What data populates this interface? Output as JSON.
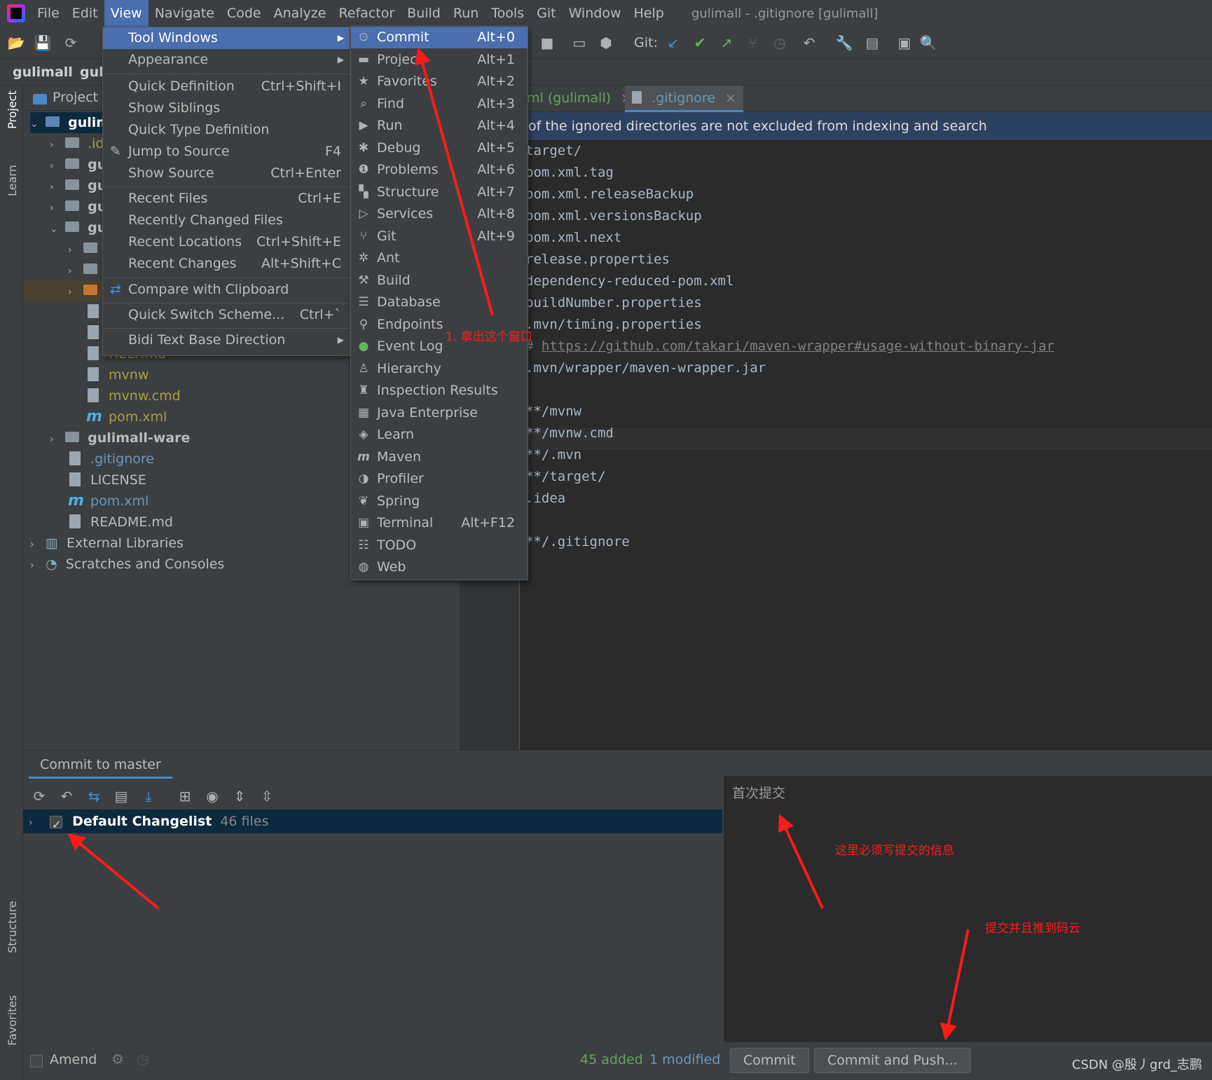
{
  "menubar": {
    "items": [
      "File",
      "Edit",
      "View",
      "Navigate",
      "Code",
      "Analyze",
      "Refactor",
      "Build",
      "Run",
      "Tools",
      "Git",
      "Window",
      "Help"
    ],
    "window_title": "gulimall - .gitignore [gulimall]"
  },
  "toolbar": {
    "git_label": "Git:"
  },
  "breadcrumb": {
    "root": "gulimall",
    "sub": "guli"
  },
  "left_stripe": {
    "project": "Project",
    "learn": "Learn",
    "structure": "Structure",
    "favorites": "Favorites"
  },
  "project_panel": {
    "title": "Project",
    "tree": {
      "root": "gulim",
      "idea": ".id",
      "gu1": "gu",
      "gu2": "gu",
      "gu3": "gu",
      "gu4": "gu",
      "help": "HELP.md",
      "mvnw": "mvnw",
      "mvnw_cmd": "mvnw.cmd",
      "pom_inner": "pom.xml",
      "ware": "gulimall-ware",
      "gitignore": ".gitignore",
      "license": "LICENSE",
      "pom": "pom.xml",
      "readme": "README.md",
      "ext_libs": "External Libraries",
      "scratches": "Scratches and Consoles"
    }
  },
  "editor": {
    "tabs": [
      "ml (gulimall)",
      ".gitignore"
    ],
    "banner": "of the ignored directories are not excluded from indexing and search",
    "lines": [
      "target/",
      "pom.xml.tag",
      "pom.xml.releaseBackup",
      "pom.xml.versionsBackup",
      "pom.xml.next",
      "release.properties",
      "dependency-reduced-pom.xml",
      "buildNumber.properties",
      ".mvn/timing.properties",
      "# ",
      ".mvn/wrapper/maven-wrapper.jar",
      "",
      "**/mvnw",
      "**/mvnw.cmd",
      "**/.mvn",
      "**/target/",
      ".idea",
      "",
      "**/.gitignore"
    ],
    "link": "https://github.com/takari/maven-wrapper#usage-without-binary-jar"
  },
  "view_menu": {
    "items": [
      {
        "label": "Tool Windows",
        "shortcut": ""
      },
      {
        "label": "Appearance",
        "shortcut": ""
      },
      {
        "label": "Quick Definition",
        "shortcut": "Ctrl+Shift+I"
      },
      {
        "label": "Show Siblings",
        "shortcut": ""
      },
      {
        "label": "Quick Type Definition",
        "shortcut": ""
      },
      {
        "label": "Jump to Source",
        "shortcut": "F4"
      },
      {
        "label": "Show Source",
        "shortcut": "Ctrl+Enter"
      },
      {
        "label": "Recent Files",
        "shortcut": "Ctrl+E"
      },
      {
        "label": "Recently Changed Files",
        "shortcut": ""
      },
      {
        "label": "Recent Locations",
        "shortcut": "Ctrl+Shift+E"
      },
      {
        "label": "Recent Changes",
        "shortcut": "Alt+Shift+C"
      },
      {
        "label": "Compare with Clipboard",
        "shortcut": ""
      },
      {
        "label": "Quick Switch Scheme...",
        "shortcut": "Ctrl+`"
      },
      {
        "label": "Bidi Text Base Direction",
        "shortcut": ""
      }
    ]
  },
  "tool_windows_menu": {
    "items": [
      {
        "label": "Commit",
        "shortcut": "Alt+0",
        "icon": "commit-icon"
      },
      {
        "label": "Project",
        "shortcut": "Alt+1",
        "icon": "folder-icon"
      },
      {
        "label": "Favorites",
        "shortcut": "Alt+2",
        "icon": "star-icon"
      },
      {
        "label": "Find",
        "shortcut": "Alt+3",
        "icon": "search-icon"
      },
      {
        "label": "Run",
        "shortcut": "Alt+4",
        "icon": "play-icon"
      },
      {
        "label": "Debug",
        "shortcut": "Alt+5",
        "icon": "bug-icon"
      },
      {
        "label": "Problems",
        "shortcut": "Alt+6",
        "icon": "warning-icon"
      },
      {
        "label": "Structure",
        "shortcut": "Alt+7",
        "icon": "structure-icon"
      },
      {
        "label": "Services",
        "shortcut": "Alt+8",
        "icon": "services-icon"
      },
      {
        "label": "Git",
        "shortcut": "Alt+9",
        "icon": "git-icon"
      },
      {
        "label": "Ant",
        "shortcut": "",
        "icon": "ant-icon"
      },
      {
        "label": "Build",
        "shortcut": "",
        "icon": "hammer-icon"
      },
      {
        "label": "Database",
        "shortcut": "",
        "icon": "database-icon"
      },
      {
        "label": "Endpoints",
        "shortcut": "",
        "icon": "endpoints-icon"
      },
      {
        "label": "Event Log",
        "shortcut": "",
        "icon": "event-log-icon"
      },
      {
        "label": "Hierarchy",
        "shortcut": "",
        "icon": "hierarchy-icon"
      },
      {
        "label": "Inspection Results",
        "shortcut": "",
        "icon": "inspection-icon"
      },
      {
        "label": "Java Enterprise",
        "shortcut": "",
        "icon": "java-ee-icon"
      },
      {
        "label": "Learn",
        "shortcut": "",
        "icon": "learn-icon"
      },
      {
        "label": "Maven",
        "shortcut": "",
        "icon": "maven-icon"
      },
      {
        "label": "Profiler",
        "shortcut": "",
        "icon": "profiler-icon"
      },
      {
        "label": "Spring",
        "shortcut": "",
        "icon": "spring-icon"
      },
      {
        "label": "Terminal",
        "shortcut": "Alt+F12",
        "icon": "terminal-icon"
      },
      {
        "label": "TODO",
        "shortcut": "",
        "icon": "todo-icon"
      },
      {
        "label": "Web",
        "shortcut": "",
        "icon": "web-icon"
      }
    ]
  },
  "commit_panel": {
    "tab": "Commit to master",
    "changelist_label": "Default Changelist",
    "changelist_count": "46 files",
    "message": "首次提交",
    "amend_label": "Amend",
    "added": "45 added",
    "modified": "1 modified",
    "commit_button": "Commit",
    "commit_push_button": "Commit and Push..."
  },
  "annotations": {
    "note1": "1. 拿出这个窗口",
    "note2": "这里必须写提交的信息",
    "note3": "提交并且推到码云"
  },
  "watermark": "CSDN @殷丿grd_志鹏",
  "colors": {
    "accent": "#4b6eaf",
    "annotation": "#ff1a1a",
    "added": "#62a35d",
    "modified": "#6897bb"
  }
}
